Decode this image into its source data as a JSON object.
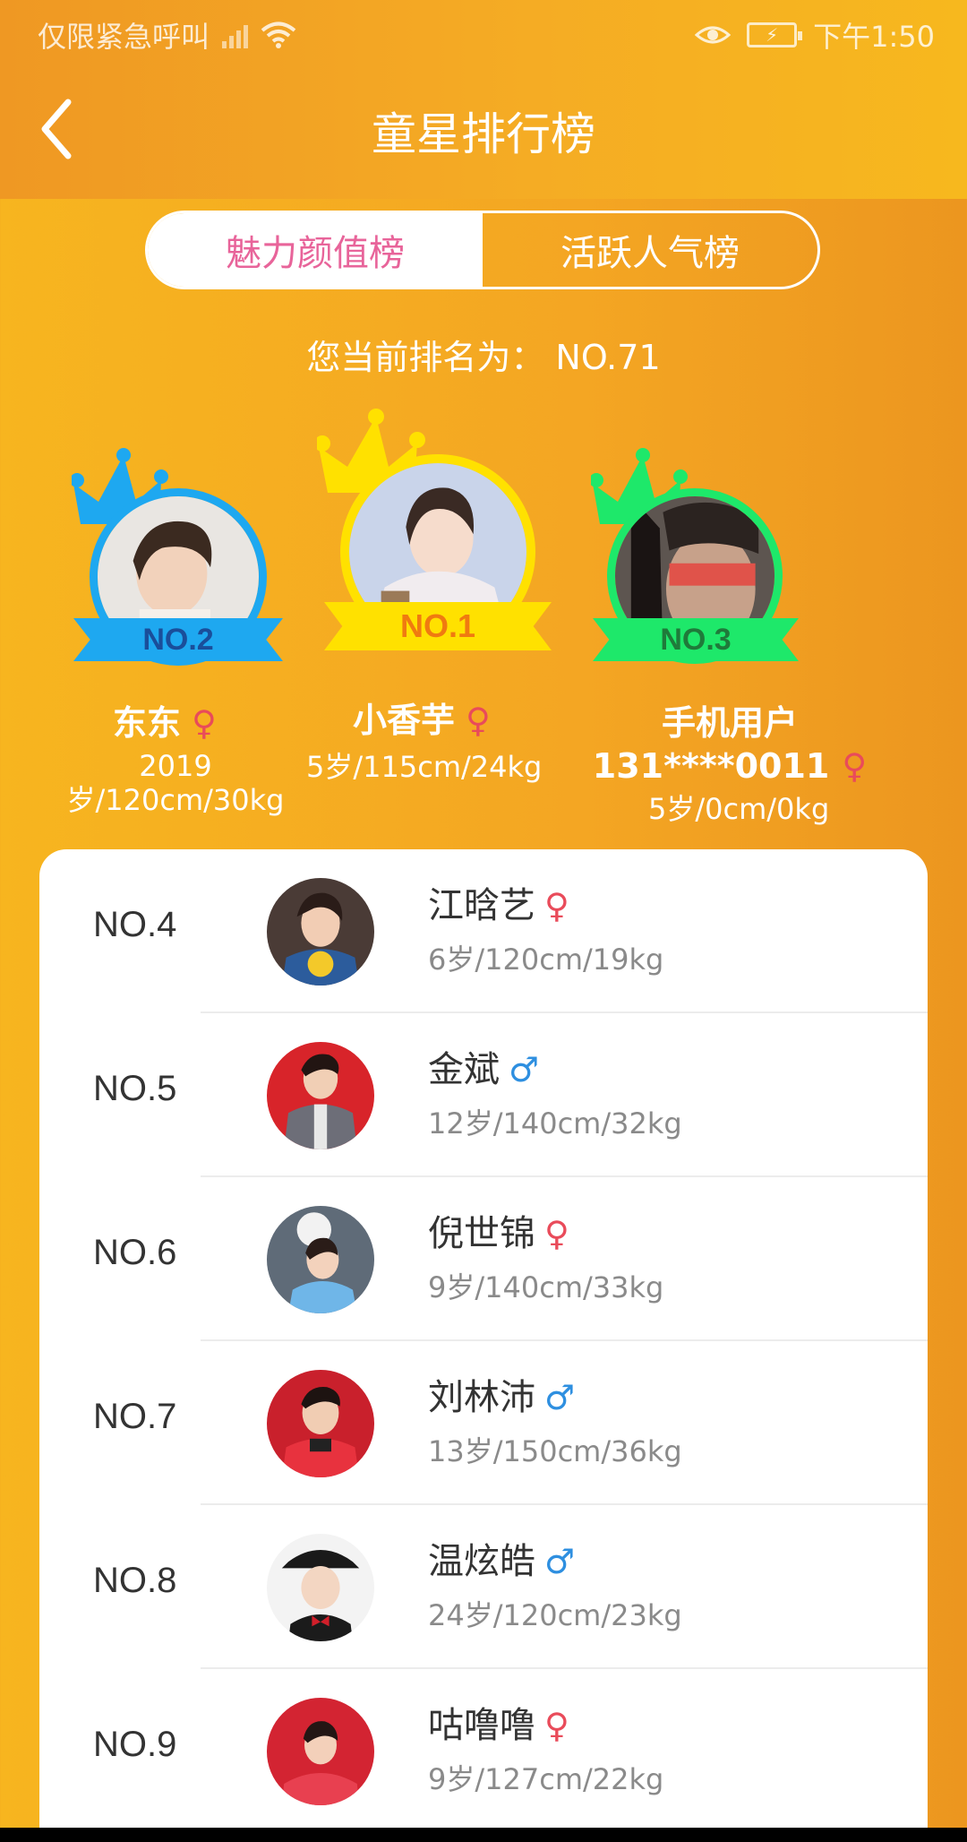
{
  "status_bar": {
    "carrier": "仅限紧急呼叫",
    "time": "下午1:50"
  },
  "header": {
    "title": "童星排行榜"
  },
  "tabs": [
    {
      "label": "魅力颜值榜",
      "active": true
    },
    {
      "label": "活跃人气榜",
      "active": false
    }
  ],
  "my_rank": {
    "label": "您当前排名为：",
    "value": "NO.71"
  },
  "podium": {
    "first": {
      "rank": "NO.1",
      "name": "小香芋",
      "gender": "♀",
      "info": "5岁/115cm/24kg"
    },
    "second": {
      "rank": "NO.2",
      "name": "东东",
      "gender": "♀",
      "info_line1": "2019",
      "info_line2": "岁/120cm/30kg"
    },
    "third": {
      "rank": "NO.3",
      "name_line1": "手机用户",
      "name_line2": "131****0011",
      "gender": "♀",
      "info": "5岁/0cm/0kg"
    }
  },
  "list": [
    {
      "rank": "NO.4",
      "name": "江晗艺",
      "gender": "♀",
      "info": "6岁/120cm/19kg"
    },
    {
      "rank": "NO.5",
      "name": "金斌",
      "gender": "♂",
      "info": "12岁/140cm/32kg"
    },
    {
      "rank": "NO.6",
      "name": "倪世锦",
      "gender": "♀",
      "info": "9岁/140cm/33kg"
    },
    {
      "rank": "NO.7",
      "name": "刘林沛",
      "gender": "♂",
      "info": "13岁/150cm/36kg"
    },
    {
      "rank": "NO.8",
      "name": "温炫皓",
      "gender": "♂",
      "info": "24岁/120cm/23kg"
    },
    {
      "rank": "NO.9",
      "name": "咕噜噜",
      "gender": "♀",
      "info": "9岁/127cm/22kg"
    }
  ],
  "colors": {
    "accent_pink": "#e8649a",
    "gold": "#ffe100",
    "blue": "#1ea8f0",
    "green": "#1ee86a",
    "female": "#e94b5a",
    "male": "#2e8fe0"
  }
}
